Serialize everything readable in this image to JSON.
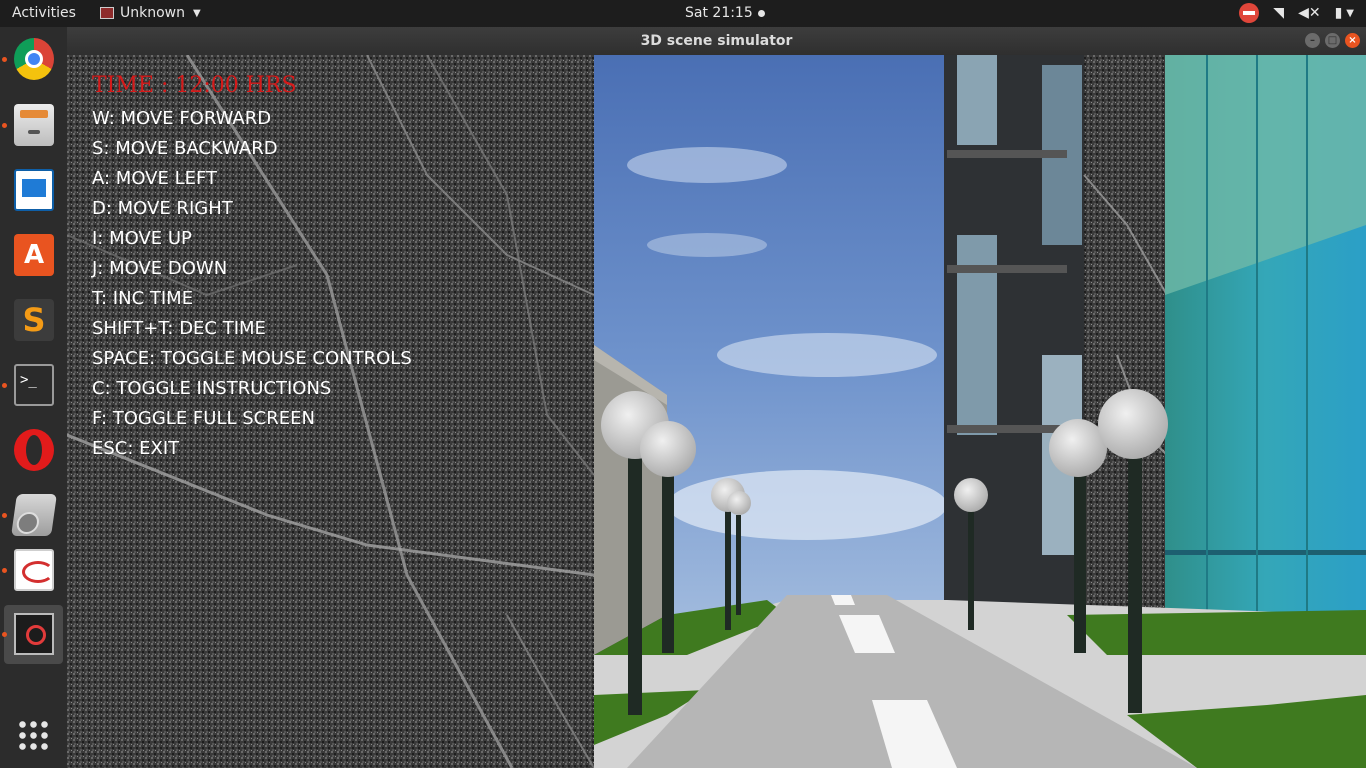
{
  "top_bar": {
    "activities": "Activities",
    "app_name": "Unknown",
    "clock": "Sat 21:15",
    "icons": [
      "do-not-disturb-icon",
      "wifi-icon",
      "volume-muted-icon",
      "battery-icon",
      "system-menu-caret-icon"
    ]
  },
  "dock": {
    "items": [
      {
        "name": "chrome",
        "running": true
      },
      {
        "name": "files",
        "running": true
      },
      {
        "name": "libreoffice-writer",
        "running": false
      },
      {
        "name": "ubuntu-software",
        "running": false
      },
      {
        "name": "sublime-text",
        "running": false
      },
      {
        "name": "terminal",
        "running": true
      },
      {
        "name": "opera",
        "running": false
      },
      {
        "name": "scanner",
        "running": true
      },
      {
        "name": "document-viewer",
        "running": true
      },
      {
        "name": "3d-scene-simulator",
        "running": true,
        "active": true
      }
    ]
  },
  "window": {
    "title": "3D scene simulator"
  },
  "hud": {
    "time": "TIME : 12:00 HRS",
    "instructions": [
      "W: MOVE FORWARD",
      "S: MOVE BACKWARD",
      "A: MOVE LEFT",
      "D: MOVE RIGHT",
      "I: MOVE UP",
      "J: MOVE DOWN",
      "T: INC TIME",
      "SHIFT+T: DEC TIME",
      "SPACE: TOGGLE MOUSE CONTROLS",
      "C: TOGGLE INSTRUCTIONS",
      "F: TOGGLE FULL SCREEN",
      "ESC: EXIT"
    ]
  },
  "colors": {
    "time_text": "#d51a1a",
    "instruction_text": "#ffffff",
    "accent": "#e95420"
  }
}
